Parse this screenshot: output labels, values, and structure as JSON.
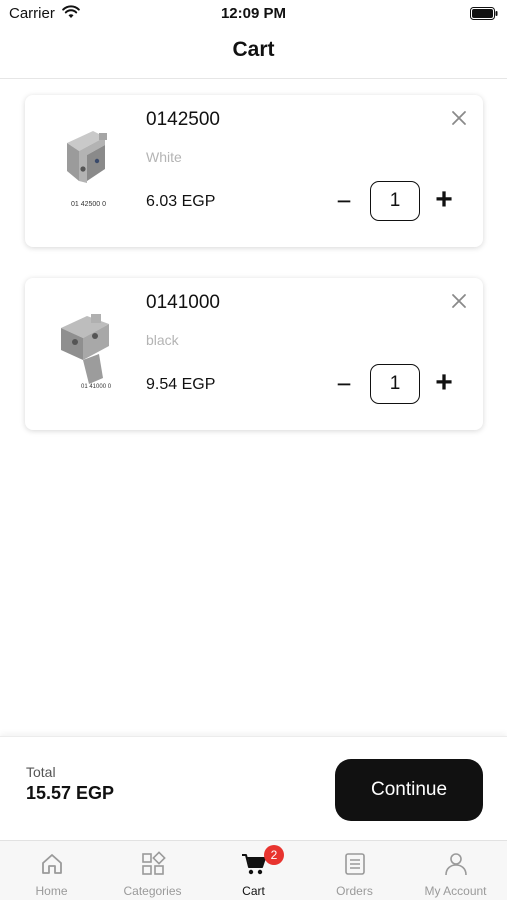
{
  "status_bar": {
    "carrier": "Carrier",
    "time": "12:09 PM"
  },
  "header": {
    "title": "Cart"
  },
  "cart": {
    "items": [
      {
        "code": "0142500",
        "color": "White",
        "price": "6.03 EGP",
        "quantity": "1",
        "thumb_caption": "01 42500 0",
        "minus": "−",
        "plus": "+"
      },
      {
        "code": "0141000",
        "color": "black",
        "price": "9.54 EGP",
        "quantity": "1",
        "thumb_caption": "01 41000 0",
        "minus": "−",
        "plus": "+"
      }
    ]
  },
  "footer": {
    "total_label": "Total",
    "total_value": "15.57 EGP",
    "continue_label": "Continue"
  },
  "tabs": [
    {
      "label": "Home",
      "icon": "home-icon"
    },
    {
      "label": "Categories",
      "icon": "categories-icon"
    },
    {
      "label": "Cart",
      "icon": "cart-icon",
      "active": true,
      "badge": "2"
    },
    {
      "label": "Orders",
      "icon": "orders-icon"
    },
    {
      "label": "My Account",
      "icon": "account-icon"
    }
  ],
  "colors": {
    "accent": "#111111",
    "badge": "#E8342F",
    "muted": "#9A9A9A"
  }
}
